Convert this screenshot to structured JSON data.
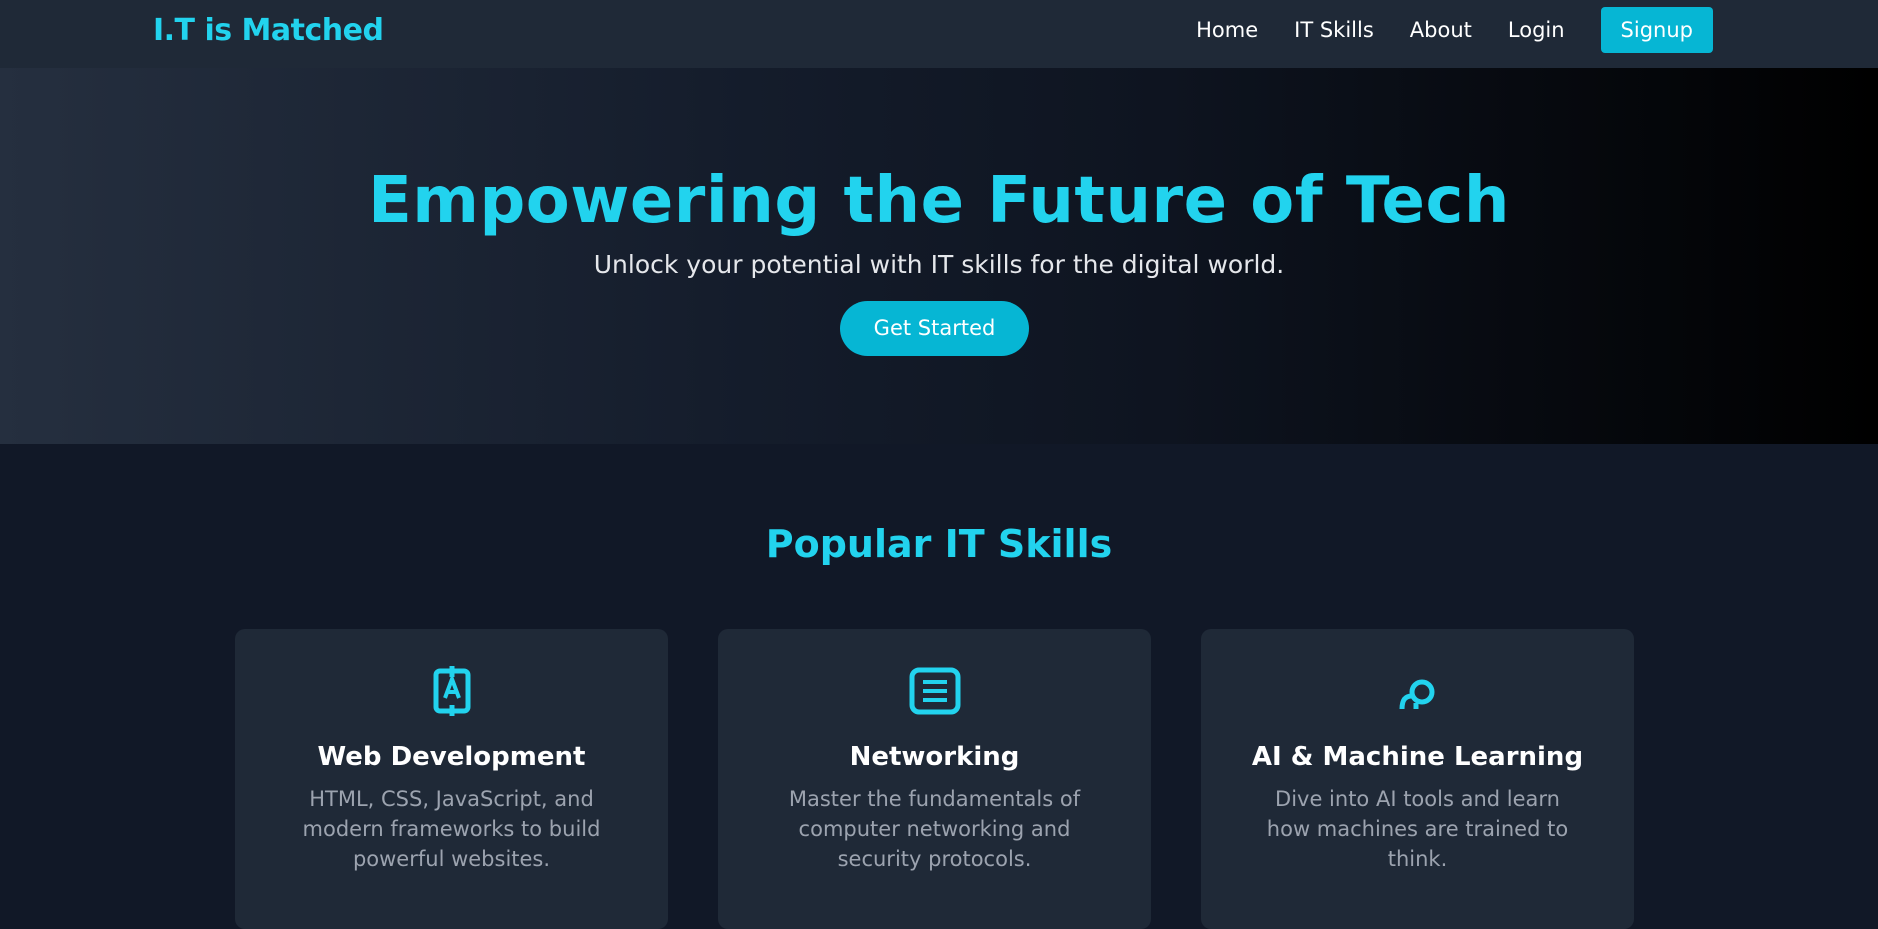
{
  "navbar": {
    "brand": "I.T is Matched",
    "links": [
      "Home",
      "IT Skills",
      "About",
      "Login"
    ],
    "signup": "Signup"
  },
  "hero": {
    "title": "Empowering the Future of Tech",
    "subtitle": "Unlock your potential with IT skills for the digital world.",
    "cta": "Get Started"
  },
  "skills": {
    "heading": "Popular IT Skills",
    "cards": [
      {
        "icon": "code-slash-icon",
        "title": "Web Development",
        "description": "HTML, CSS, JavaScript, and modern frameworks to build powerful websites."
      },
      {
        "icon": "document-lines-icon",
        "title": "Networking",
        "description": "Master the fundamentals of computer networking and security protocols."
      },
      {
        "icon": "brain-icon",
        "title": "AI & Machine Learning",
        "description": "Dive into AI tools and learn how machines are trained to think."
      }
    ]
  },
  "colors": {
    "accent": "#22d3ee",
    "button": "#06b6d4",
    "navbar_bg": "#1f2937",
    "page_bg": "#111827",
    "card_bg": "#1f2937",
    "muted_text": "#9ca3af"
  }
}
